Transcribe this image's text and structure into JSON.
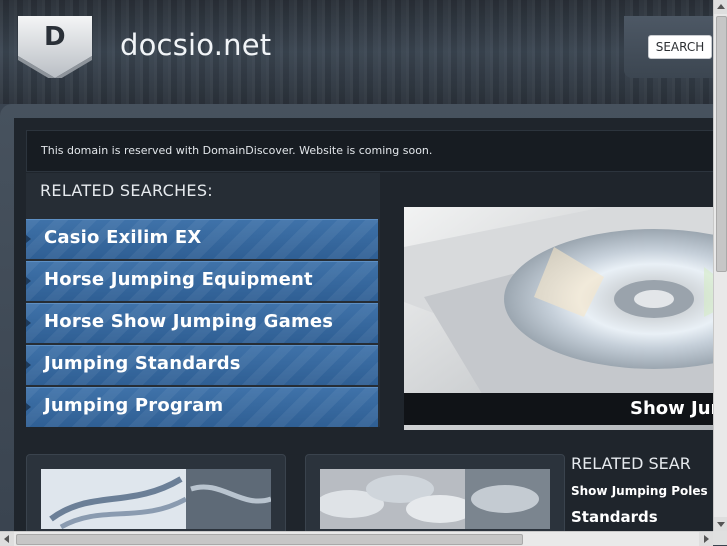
{
  "header": {
    "logo_letter": "D",
    "site_title": "docsio.net",
    "search_label": "SEARCH"
  },
  "notice": {
    "text": "This domain is reserved with DomainDiscover. Website is coming soon."
  },
  "related": {
    "title": "RELATED SEARCHES:",
    "items": [
      {
        "label": "Casio Exilim EX"
      },
      {
        "label": "Horse Jumping Equipment"
      },
      {
        "label": "Horse Show Jumping Games"
      },
      {
        "label": "Jumping Standards"
      },
      {
        "label": "Jumping Program"
      }
    ]
  },
  "hero": {
    "caption": "Show Jum"
  },
  "right_related": {
    "title": "RELATED SEAR",
    "links": [
      "Show Jumping Poles",
      "Standards"
    ]
  },
  "colors": {
    "accent_blue": "#3f72a9",
    "header_dark": "#2a3038",
    "panel_dark": "#1f252c"
  },
  "icons": [
    "logo-shield-icon",
    "arrow-right-icon",
    "scroll-up-icon",
    "scroll-down-icon",
    "scroll-left-icon",
    "scroll-right-icon"
  ]
}
